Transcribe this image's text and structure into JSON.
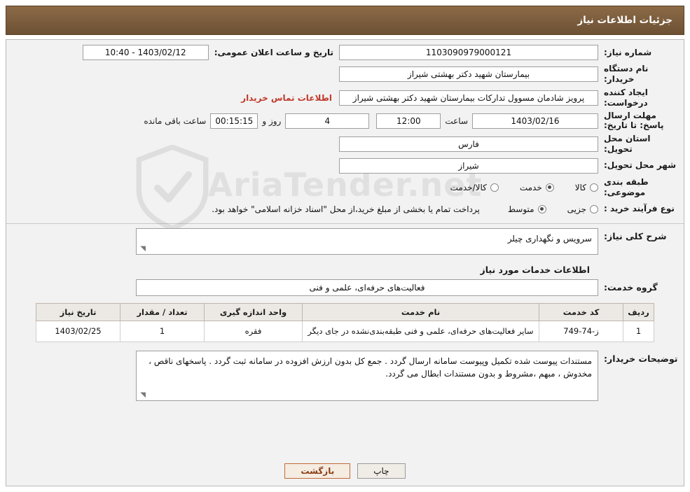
{
  "header": {
    "title": "جزئیات اطلاعات نیاز"
  },
  "watermark": {
    "text": "AriaTender.net"
  },
  "form": {
    "need_number": {
      "label": "شماره نیاز:",
      "value": "1103090979000121"
    },
    "announce_datetime": {
      "label": "تاریخ و ساعت اعلان عمومی:",
      "value": "1403/02/12 - 10:40"
    },
    "buyer_org": {
      "label": "نام دستگاه خریدار:",
      "value": "بیمارستان شهید دکتر بهشتی شیراز"
    },
    "requester": {
      "label": "ایجاد کننده درخواست:",
      "value": "پرویز شادمان مسوول تدارکات بیمارستان شهید دکتر بهشتی شیراز"
    },
    "contact_link": {
      "label": "اطلاعات تماس خریدار"
    },
    "deadline": {
      "label": "مهلت ارسال پاسخ: تا تاریخ:",
      "date": "1403/02/16",
      "time_label": "ساعت",
      "time": "12:00",
      "days": "4",
      "days_label": "روز و",
      "countdown": "00:15:15",
      "countdown_label": "ساعت باقی مانده"
    },
    "province": {
      "label": "استان محل تحویل:",
      "value": "فارس"
    },
    "city": {
      "label": "شهر محل تحویل:",
      "value": "شیراز"
    },
    "category": {
      "label": "طبقه بندی موضوعی:",
      "options": [
        "کالا",
        "خدمت",
        "کالا/خدمت"
      ],
      "selected": "خدمت"
    },
    "purchase_type": {
      "label": "نوع فرآیند خرید :",
      "options": [
        "جزیی",
        "متوسط"
      ],
      "selected": "متوسط",
      "note": "پرداخت تمام یا بخشی از مبلغ خرید،از محل \"اسناد خزانه اسلامی\" خواهد بود."
    }
  },
  "description": {
    "label": "شرح کلی نیاز:",
    "value": "سرویس و نگهداری چیلر"
  },
  "services_section_title": "اطلاعات خدمات مورد نیاز",
  "service_group": {
    "label": "گروه خدمت:",
    "value": "فعالیت‌های حرفه‌ای، علمی و فنی"
  },
  "table": {
    "headers": [
      "ردیف",
      "کد خدمت",
      "نام خدمت",
      "واحد اندازه گیری",
      "تعداد / مقدار",
      "تاریخ نیاز"
    ],
    "rows": [
      {
        "row": "1",
        "code": "ز-74-749",
        "name": "سایر فعالیت‌های حرفه‌ای، علمی و فنی طبقه‌بندی‌نشده در جای دیگر",
        "unit": "فقره",
        "qty": "1",
        "date": "1403/02/25"
      }
    ]
  },
  "buyer_notes": {
    "label": "توضیحات خریدار:",
    "value": "مستندات پیوست شده تکمیل وپیوست سامانه ارسال گردد . جمع کل بدون ارزش افزوده در سامانه ثبت گردد . پاسخهای ناقص ، مخدوش ، مبهم ،مشروط و بدون مستندات ابطال می گردد."
  },
  "footer": {
    "print": "چاپ",
    "back": "بازگشت"
  },
  "colors": {
    "header_bg": "#7a5c3e",
    "link": "#c0392b",
    "panel_bg": "#f2f2f2"
  }
}
